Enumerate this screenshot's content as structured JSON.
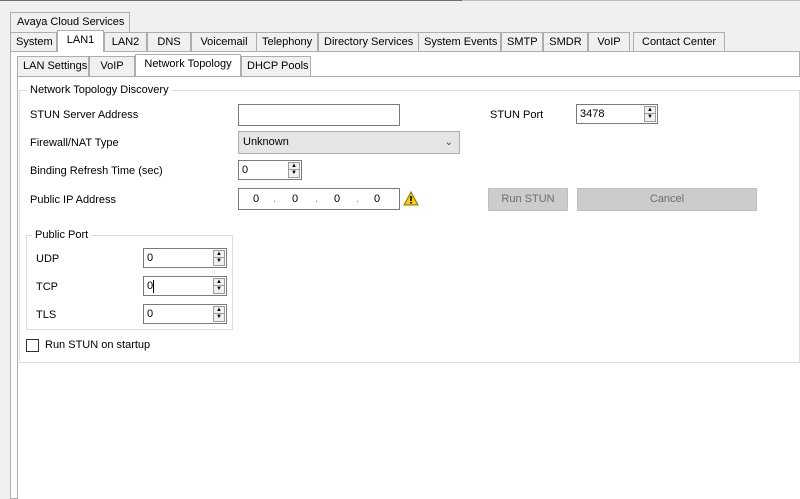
{
  "top_tab": "Avaya Cloud Services",
  "tabs_level1": [
    "System",
    "LAN1",
    "LAN2",
    "DNS",
    "Voicemail",
    "Telephony",
    "Directory Services",
    "System Events",
    "SMTP",
    "SMDR",
    "VoIP",
    "Contact Center"
  ],
  "tabs_level1_active": "LAN1",
  "tabs_level2": [
    "LAN Settings",
    "VoIP",
    "Network Topology",
    "DHCP Pools"
  ],
  "tabs_level2_active": "Network Topology",
  "discovery": {
    "group_title": "Network Topology Discovery",
    "stun_server_label": "STUN Server Address",
    "stun_server_value": "",
    "stun_port_label": "STUN Port",
    "stun_port_value": "3478",
    "firewall_label": "Firewall/NAT Type",
    "firewall_value": "Unknown",
    "binding_label": "Binding Refresh Time (sec)",
    "binding_value": "0",
    "public_ip_label": "Public IP Address",
    "public_ip_octets": [
      "0",
      "0",
      "0",
      "0"
    ],
    "run_stun_button": "Run STUN",
    "cancel_button": "Cancel"
  },
  "public_port": {
    "group_title": "Public Port",
    "udp_label": "UDP",
    "udp_value": "0",
    "tcp_label": "TCP",
    "tcp_value": "0",
    "tls_label": "TLS",
    "tls_value": "0"
  },
  "run_on_startup_label": "Run STUN on startup",
  "run_on_startup_checked": false,
  "colors": {
    "background": "#f0f0f0",
    "panel": "#ffffff",
    "disabled_button": "#cccccc",
    "warning_icon": "#f5d000"
  }
}
